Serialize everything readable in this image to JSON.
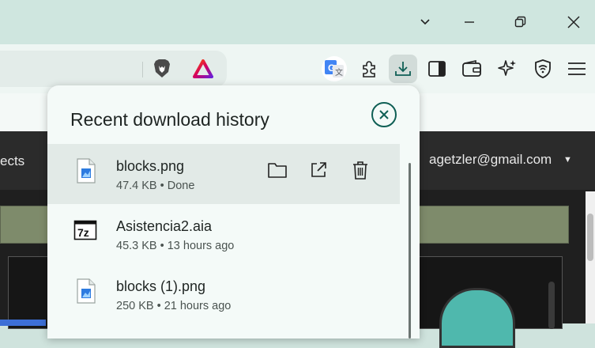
{
  "window": {
    "controls": [
      "chevron-down-icon",
      "minimize-icon",
      "restore-icon",
      "close-icon"
    ]
  },
  "toolbar": {
    "extension_icons": [
      "brave-shields-icon",
      "brave-rewards-icon",
      "google-translate-icon",
      "puzzle-icon",
      "download-icon",
      "sidebar-icon",
      "wallet-icon",
      "leo-ai-icon",
      "vpn-shield-icon",
      "menu-icon"
    ]
  },
  "page": {
    "tab_text": "ects",
    "account": "agetzler@gmail.com"
  },
  "downloads": {
    "title": "Recent download history",
    "items": [
      {
        "name": "blocks.png",
        "meta": "47.4 KB • Done",
        "icon": "image-file-icon"
      },
      {
        "name": "Asistencia2.aia",
        "meta": "45.3 KB • 13 hours ago",
        "icon": "7z-archive-icon"
      },
      {
        "name": "blocks (1).png",
        "meta": "250 KB • 21 hours ago",
        "icon": "image-file-icon"
      }
    ]
  },
  "colors": {
    "accent": "#0f5f55",
    "title_bar": "#cfe6df",
    "popup_bg": "#f4faf8"
  }
}
